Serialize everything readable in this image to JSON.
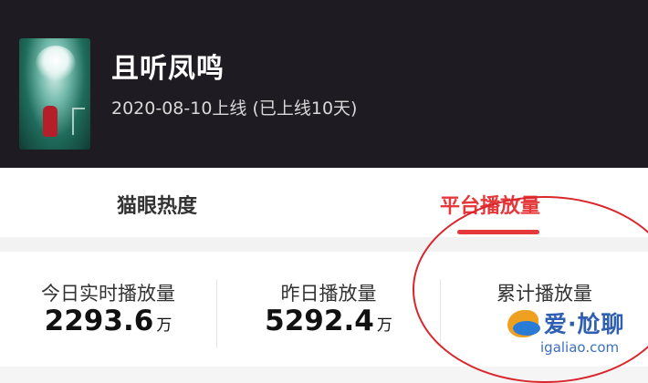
{
  "header": {
    "title": "且听凤鸣",
    "subtitle": "2020-08-10上线 (已上线10天)"
  },
  "tabs": [
    {
      "label": "猫眼热度",
      "active": false
    },
    {
      "label": "平台播放量",
      "active": true
    }
  ],
  "stats": [
    {
      "label": "今日实时播放量",
      "value": "2293.6",
      "unit": "万"
    },
    {
      "label": "昨日播放量",
      "value": "5292.4",
      "unit": "万"
    },
    {
      "label": "累计播放量",
      "value": "",
      "unit": ""
    }
  ],
  "watermark": {
    "text": "爱·尬聊",
    "url": "igaliao.com"
  },
  "colors": {
    "header_bg": "#1e1b22",
    "accent": "#e5383b",
    "annotation_circle": "#d9262c"
  },
  "icons": [
    "poster-image",
    "watermark-logo-icon"
  ]
}
